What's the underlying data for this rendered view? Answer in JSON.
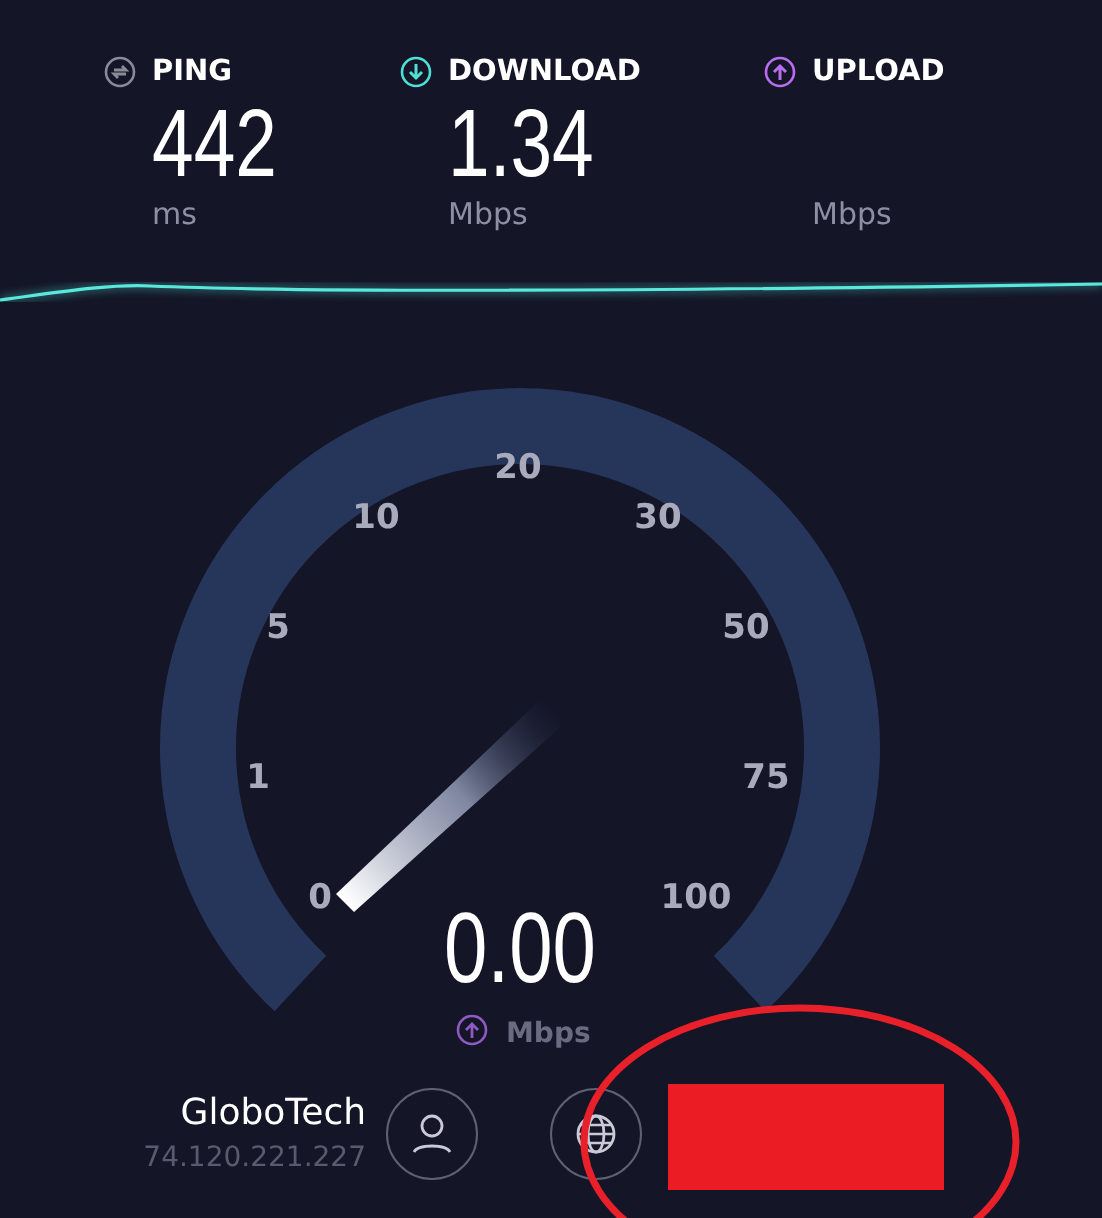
{
  "metrics": [
    {
      "kind": "ping",
      "label": "PING",
      "value": "442",
      "unit": "ms"
    },
    {
      "kind": "download",
      "label": "DOWNLOAD",
      "value": "1.34",
      "unit": "Mbps"
    },
    {
      "kind": "upload",
      "label": "UPLOAD",
      "unit": "Mbps"
    }
  ],
  "gauge": {
    "scale": [
      "0",
      "1",
      "5",
      "10",
      "20",
      "30",
      "50",
      "75",
      "100"
    ],
    "reading": "0.00",
    "unit": "Mbps"
  },
  "host": {
    "name": "GloboTech",
    "ip": "74.120.221.227"
  },
  "annotations": [
    {
      "kind": "redaction",
      "color": "#ec1c24"
    },
    {
      "kind": "ellipse",
      "color": "#e8202a"
    }
  ]
}
